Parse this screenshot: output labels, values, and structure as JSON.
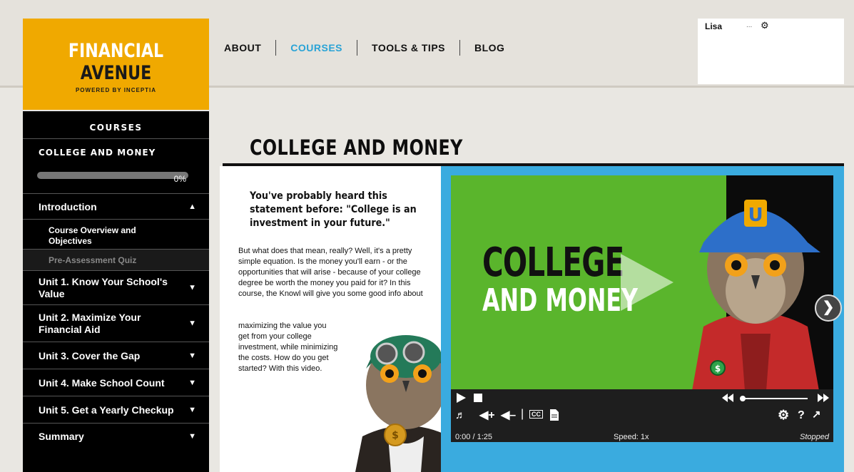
{
  "logo": {
    "word1": "FINANCIAL",
    "word2": "AVENUE",
    "tagline": "POWERED BY INCEPTIA"
  },
  "nav": {
    "about": "ABOUT",
    "courses": "COURSES",
    "tools": "TOOLS & TIPS",
    "blog": "BLOG"
  },
  "user": {
    "name": "Lisa",
    "extra": "..."
  },
  "sidebar": {
    "header": "COURSES",
    "course_title": "COLLEGE AND MONEY",
    "progress_label": "0%",
    "progress_fraction": 0,
    "intro": "Introduction",
    "sub1": "Course Overview and Objectives",
    "sub2": "Pre-Assessment Quiz",
    "units": [
      "Unit 1. Know Your School's Value",
      "Unit 2. Maximize Your Financial Aid",
      "Unit 3. Cover the Gap",
      "Unit 4. Make School Count",
      "Unit 5. Get a Yearly Checkup",
      "Summary"
    ]
  },
  "main": {
    "title": "COLLEGE AND MONEY",
    "lead": "You've probably heard this statement before: \"College is an investment in your future.\"",
    "para1": "But what does that mean, really? Well, it's a pretty simple equation. Is the money you'll earn - or the opportunities that will arise - because of your college degree be worth the money you paid for it? In this course, the Knowl will give you some good info about",
    "para2": "maximizing the value you get from your college investment, while minimizing the costs. How do you get started? With this video."
  },
  "video": {
    "title_line1": "COLLEGE",
    "title_line2": "AND MONEY",
    "time": "0:00 / 1:25",
    "speed": "Speed: 1x",
    "state": "Stopped",
    "cc": "CC"
  },
  "colors": {
    "accent": "#29a3d6",
    "logo_bg": "#f0a900",
    "video_green": "#5ab52c",
    "video_frame": "#3aabdf"
  }
}
